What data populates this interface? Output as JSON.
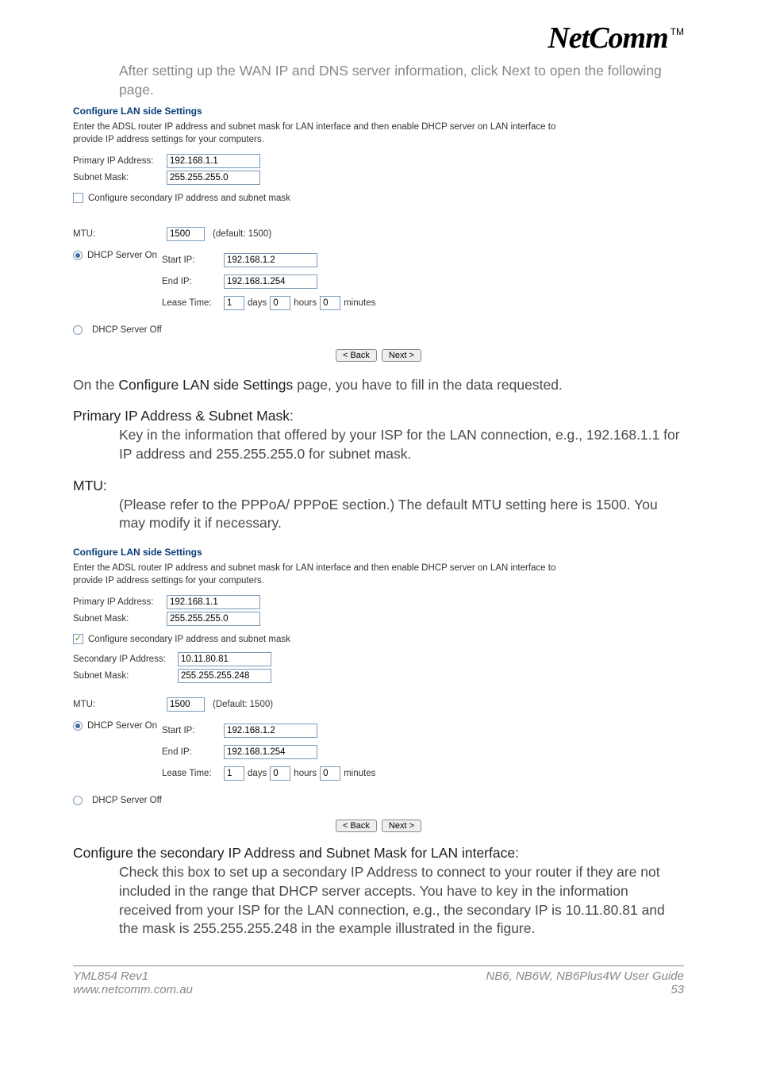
{
  "logo": {
    "part1": "Net",
    "part2": "Comm",
    "tm": "TM"
  },
  "intro": "After setting up the WAN IP and DNS server information, click Next to open the following page.",
  "form1": {
    "title": "Configure LAN side Settings",
    "desc": "Enter the ADSL router IP address and subnet mask for LAN interface and then enable DHCP server on LAN interface to provide IP address settings for your computers.",
    "primary_ip_lbl": "Primary IP Address:",
    "primary_ip": "192.168.1.1",
    "subnet_lbl": "Subnet Mask:",
    "subnet": "255.255.255.0",
    "secondary_chk_lbl": "Configure secondary IP address and subnet mask",
    "mtu_lbl": "MTU:",
    "mtu": "1500",
    "mtu_hint": "(default: 1500)",
    "dhcp_on_lbl": "DHCP Server On",
    "start_ip_lbl": "Start IP:",
    "start_ip": "192.168.1.2",
    "end_ip_lbl": "End IP:",
    "end_ip": "192.168.1.254",
    "lease_lbl": "Lease Time:",
    "lease_days": "1",
    "lease_days_lbl": "days",
    "lease_hours": "0",
    "lease_hours_lbl": "hours",
    "lease_min": "0",
    "lease_min_lbl": "minutes",
    "dhcp_off_lbl": "DHCP Server Off",
    "back_btn": "< Back",
    "next_btn": "Next >"
  },
  "body1": {
    "line_prefix": "On the ",
    "line_bold": "Configure LAN side Settings",
    "line_suffix": " page, you have to fill in the data requested.",
    "h_primary": "Primary IP Address & Subnet Mask:",
    "p_primary": "Key in the information that offered by your ISP for the LAN connection, e.g., 192.168.1.1 for IP address and 255.255.255.0 for subnet mask.",
    "h_mtu": "MTU:",
    "p_mtu_1": "(Please refer to the PPPoA/ PPPoE section.) The default ",
    "p_mtu_bold": "MTU",
    "p_mtu_2": " setting here is 1500. You may modify it if necessary."
  },
  "form2": {
    "title": "Configure LAN side Settings",
    "desc": "Enter the ADSL router IP address and subnet mask for LAN interface and then enable DHCP server on LAN interface to provide IP address settings for your computers.",
    "primary_ip_lbl": "Primary IP Address:",
    "primary_ip": "192.168.1.1",
    "subnet_lbl": "Subnet Mask:",
    "subnet": "255.255.255.0",
    "secondary_chk_lbl": "Configure secondary IP address and subnet mask",
    "sec_ip_lbl": "Secondary IP Address:",
    "sec_ip": "10.11.80.81",
    "sec_mask_lbl": "Subnet Mask:",
    "sec_mask": "255.255.255.248",
    "mtu_lbl": "MTU:",
    "mtu": "1500",
    "mtu_hint": "(Default: 1500)",
    "dhcp_on_lbl": "DHCP Server On",
    "start_ip_lbl": "Start IP:",
    "start_ip": "192.168.1.2",
    "end_ip_lbl": "End IP:",
    "end_ip": "192.168.1.254",
    "lease_lbl": "Lease Time:",
    "lease_days": "1",
    "lease_days_lbl": "days",
    "lease_hours": "0",
    "lease_hours_lbl": "hours",
    "lease_min": "0",
    "lease_min_lbl": "minutes",
    "dhcp_off_lbl": "DHCP Server Off",
    "back_btn": "< Back",
    "next_btn": "Next >"
  },
  "body2": {
    "h_sec": "Configure the secondary IP Address and Subnet Mask for LAN interface:",
    "p_sec": "Check this box to set up a secondary IP Address to connect to your router if they are not included in the range that DHCP server accepts. You have to key in the information received from your ISP for the LAN connection, e.g., the secondary IP is 10.11.80.81 and the mask is 255.255.255.248 in the example illustrated in the figure."
  },
  "footer": {
    "l1": "YML854 Rev1",
    "l2": "www.netcomm.com.au",
    "r1_a": "NB6, NB6W, NB6Plus4W ",
    "r1_b": "User Guide",
    "r2": "53"
  }
}
